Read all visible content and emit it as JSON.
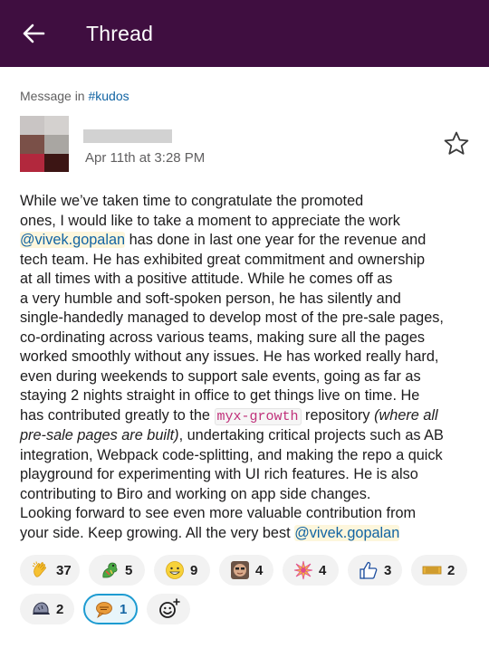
{
  "header": {
    "title": "Thread",
    "background": "#3f0e40"
  },
  "context": {
    "prefix": "Message in ",
    "channel": "#kudos"
  },
  "message": {
    "timestamp": "Apr 11th at 3:28 PM",
    "lines": {
      "l1": "While we’ve taken time to congratulate the promoted",
      "l2": "ones, I would like to take a moment to appreciate the work",
      "l3_mention": "@vivek.gopalan",
      "l3_rest": " has done in last one year for the revenue and",
      "l4": "tech team. He has exhibited great commitment and ownership",
      "l5": "at all times with a positive attitude. While he comes off as",
      "l6": "a very humble and soft-spoken person, he has silently and",
      "l7": "single-handedly managed to develop most of the pre-sale pages,",
      "l8": "co-ordinating across various teams, making sure all the pages",
      "l9": "worked smoothly without any issues. He has worked really hard,",
      "l10": "even during weekends to support sale events, going as far as",
      "l11": "staying 2 nights straight in office to get things live on time. He",
      "l12_a": "has contributed greatly to the ",
      "l12_code": "myx-growth",
      "l12_b": " repository ",
      "l12_italic": "(where all",
      "l13_italic": "pre-sale pages are built)",
      "l13_rest": ", undertaking critical projects such as AB",
      "l14": "integration, Webpack code-splitting, and making the repo a quick",
      "l15": "playground for experimenting with UI rich features. He is also",
      "l16": "contributing to Biro and working on app side changes.",
      "l17": "Looking forward to see even more valuable contribution from",
      "l18_a": "your side. Keep growing. All the very best ",
      "l18_mention": "@vivek.gopalan"
    }
  },
  "reactions": [
    {
      "icon": "clap-icon",
      "count": "37"
    },
    {
      "icon": "dragon-icon",
      "count": "5"
    },
    {
      "icon": "grin-face-icon",
      "count": "9"
    },
    {
      "icon": "custom-face-icon",
      "count": "4"
    },
    {
      "icon": "sparkle-burst-icon",
      "count": "4"
    },
    {
      "icon": "thumbs-up-icon",
      "count": "3"
    },
    {
      "icon": "ticket-icon",
      "count": "2"
    },
    {
      "icon": "cap-icon",
      "count": "2"
    },
    {
      "icon": "speech-bubble-icon",
      "count": "1",
      "selected": true
    }
  ]
}
